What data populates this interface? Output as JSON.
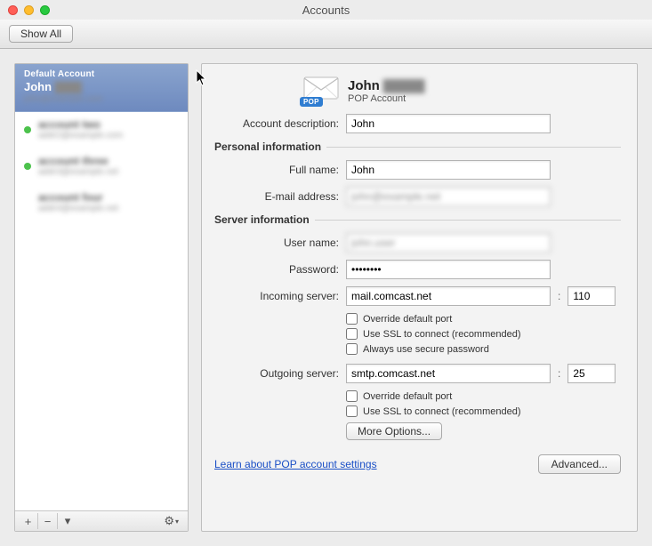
{
  "window": {
    "title": "Accounts"
  },
  "toolbar": {
    "show_all": "Show All"
  },
  "sidebar": {
    "default_label": "Default Account",
    "accounts": [
      {
        "name": "John",
        "sub": "john@example.com",
        "selected": true,
        "has_dot": false
      },
      {
        "name": "account two",
        "sub": "addr2@example.com",
        "selected": false,
        "has_dot": true
      },
      {
        "name": "account three",
        "sub": "addr3@example.net",
        "selected": false,
        "has_dot": true
      },
      {
        "name": "account four",
        "sub": "addr4@example.net",
        "selected": false,
        "has_dot": false
      }
    ],
    "add_tooltip": "+",
    "remove_tooltip": "−",
    "dropdown_tooltip": "▾",
    "gear_tooltip": "⚙"
  },
  "main": {
    "header_name": "John",
    "header_type": "POP Account",
    "labels": {
      "account_description": "Account description:",
      "personal_info": "Personal information",
      "full_name": "Full name:",
      "email": "E-mail address:",
      "server_info": "Server information",
      "user_name": "User name:",
      "password": "Password:",
      "incoming": "Incoming server:",
      "override_port": "Override default port",
      "use_ssl": "Use SSL to connect (recommended)",
      "secure_pass": "Always use secure password",
      "outgoing": "Outgoing server:",
      "more_options": "More Options...",
      "learn_link": "Learn about POP account settings",
      "advanced": "Advanced..."
    },
    "values": {
      "account_description": "John",
      "full_name": "John",
      "email": "john@example.net",
      "user_name": "john.user",
      "password": "••••••••",
      "incoming_server": "mail.comcast.net",
      "incoming_port": "110",
      "outgoing_server": "smtp.comcast.net",
      "outgoing_port": "25",
      "incoming_override": false,
      "incoming_ssl": false,
      "incoming_secure_pass": false,
      "outgoing_override": false,
      "outgoing_ssl": false
    },
    "pop_badge": "POP"
  }
}
